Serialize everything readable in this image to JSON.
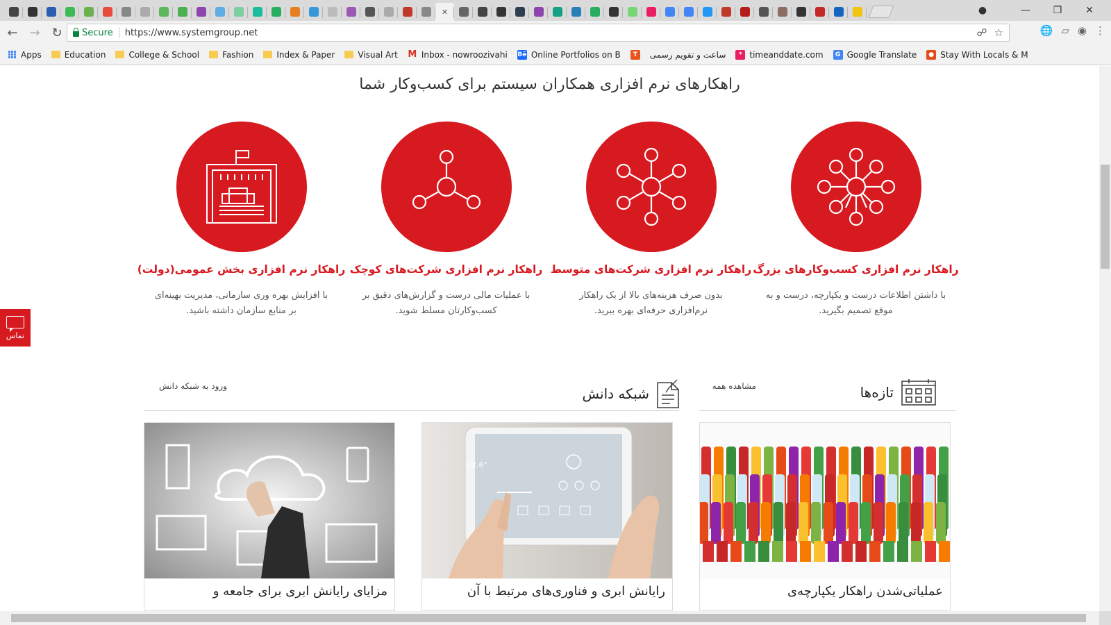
{
  "browser": {
    "tab_count": 46,
    "active_tab_index": 23,
    "address": {
      "secure_label": "Secure",
      "url": "https://www.systemgroup.net"
    },
    "bookmarks": [
      {
        "label": "Apps",
        "icon": "apps-grid-icon"
      },
      {
        "label": "Education",
        "icon": "folder-icon"
      },
      {
        "label": "College & School",
        "icon": "folder-icon"
      },
      {
        "label": "Fashion",
        "icon": "folder-icon"
      },
      {
        "label": "Index & Paper",
        "icon": "folder-icon"
      },
      {
        "label": "Visual Art",
        "icon": "folder-icon"
      },
      {
        "label": "Inbox - nowroozivahi",
        "icon": "gmail-icon"
      },
      {
        "label": "Online Portfolios on B",
        "icon": "behance-icon"
      },
      {
        "label": "",
        "icon": "t-icon"
      },
      {
        "label": "ساعت و تقویم رسمی",
        "icon": "none"
      },
      {
        "label": "timeanddate.com",
        "icon": "timeanddate-icon"
      },
      {
        "label": "Google Translate",
        "icon": "translate-icon"
      },
      {
        "label": "Stay With Locals & M",
        "icon": "couchsurfing-icon"
      }
    ]
  },
  "page": {
    "section_title": "راهکارهای نرم افزاری همکاران سیستم برای کسب‌وکار شما",
    "solutions": [
      {
        "title": "راهکار نرم افزاری کسب‌وکارهای بزرگ",
        "desc": "با داشتن اطلاعات درست و یکپارچه، درست و به موقع تصمیم بگیرید.",
        "icon": "large-network-icon"
      },
      {
        "title": "راهکار نرم افزاری شرکت‌های متوسط",
        "desc": "بدون صرف هزینه‌های بالا از یک راهکار نرم‌افزاری حرفه‌ای بهره ببرید.",
        "icon": "medium-network-icon"
      },
      {
        "title": "راهکار نرم افزاری شرکت‌های کوچک",
        "desc": "با عملیات مالی درست و گزارش‌های دقیق بر کسب‌وکارتان مسلط شوید.",
        "icon": "small-network-icon"
      },
      {
        "title": "راهکار نرم افزاری بخش عمومی(دولت)",
        "desc": "با افزایش بهره وری سازمانی، مدیریت بهینه‌ای بر منابع سازمان داشته باشید.",
        "icon": "government-building-icon"
      }
    ],
    "contact_label": "تماس",
    "news": {
      "title": "تازه‌ها",
      "link": "مشاهده همه",
      "card_title": "عملیاتی‌شدن راهکار یکپارچه‌ی"
    },
    "knowledge": {
      "title": "شبکه دانش",
      "link": "ورود به شبکه دانش",
      "cards": [
        {
          "title": "رایانش ابری و فناوری‌های مرتبط با آن"
        },
        {
          "title": "مزایای رایانش ابری برای جامعه و"
        }
      ]
    }
  },
  "colors": {
    "brand_red": "#d71920",
    "secure_green": "#0b8043"
  }
}
